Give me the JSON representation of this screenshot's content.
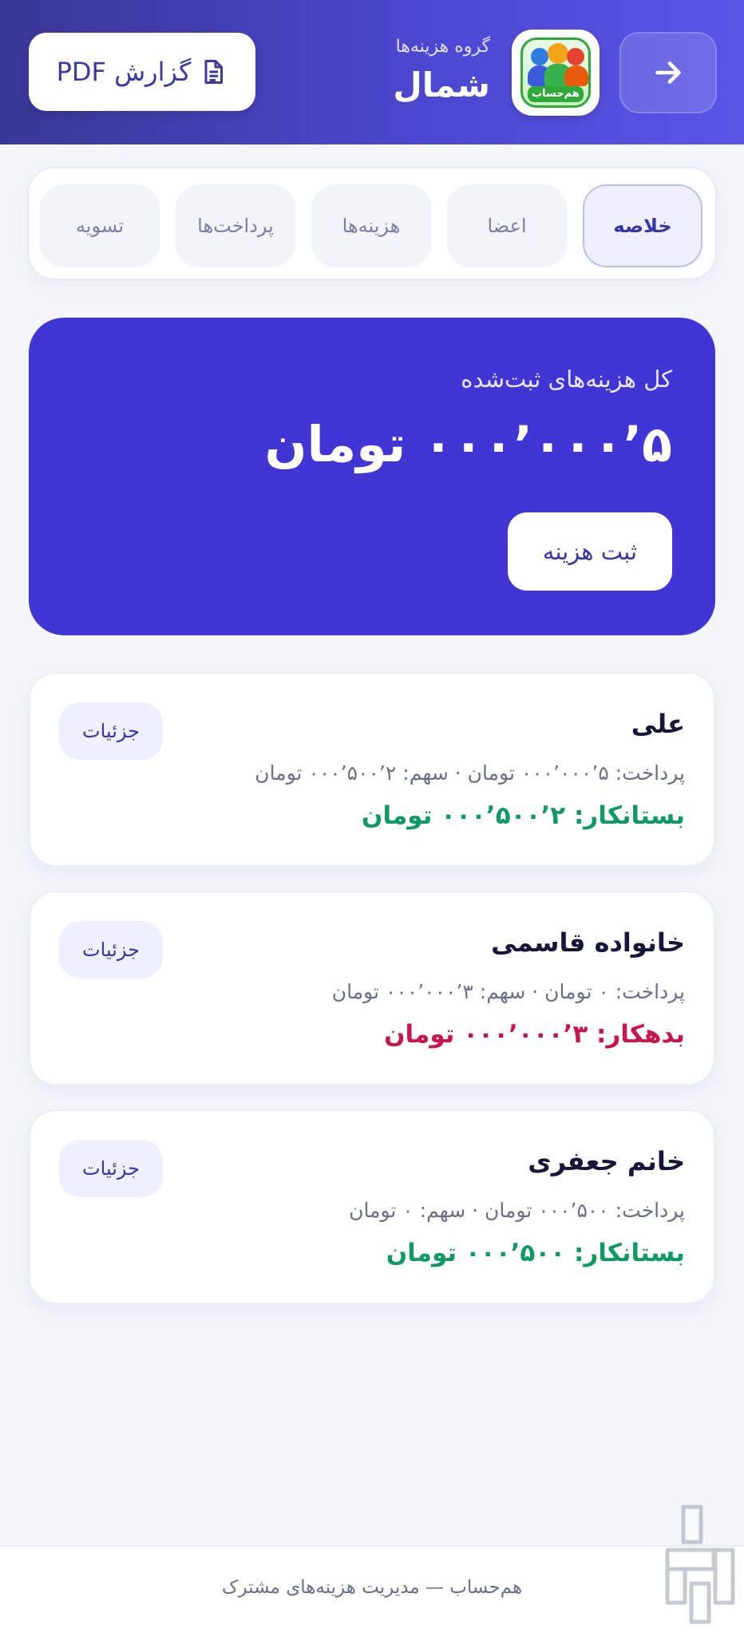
{
  "header": {
    "group_caption": "گروه هزینه‌ها",
    "group_name": "شمال",
    "pdf_label": "گزارش PDF",
    "logo_text": "هم‌حساب",
    "colors": {
      "gradient_start": "#3a3796",
      "gradient_end": "#5a55e6"
    }
  },
  "tabs": [
    {
      "label": "خلاصه",
      "active": true
    },
    {
      "label": "اعضا",
      "active": false
    },
    {
      "label": "هزینه‌ها",
      "active": false
    },
    {
      "label": "پرداخت‌ها",
      "active": false
    },
    {
      "label": "تسویه",
      "active": false
    }
  ],
  "summary": {
    "label": "کل هزینه‌های ثبت‌شده",
    "amount": "۵’۰۰۰’۰۰۰ تومان",
    "add_button": "ثبت هزینه",
    "color": "#4135d6"
  },
  "members": [
    {
      "name": "علی",
      "info": "پرداخت: ۵’۰۰۰’۰۰۰ تومان · سهم: ۲’۵۰۰’۰۰۰ تومان",
      "balance": "بستانکار: ۲’۵۰۰’۰۰۰ تومان",
      "status": "credit",
      "details": "جزئیات"
    },
    {
      "name": "خانواده قاسمی",
      "info": "پرداخت: ۰ تومان · سهم: ۳’۰۰۰’۰۰۰ تومان",
      "balance": "بدهکار: ۳’۰۰۰’۰۰۰ تومان",
      "status": "debt",
      "details": "جزئیات"
    },
    {
      "name": "خانم جعفری",
      "info": "پرداخت: ۵۰۰’۰۰۰ تومان · سهم: ۰ تومان",
      "balance": "بستانکار: ۵۰۰’۰۰۰ تومان",
      "status": "credit",
      "details": "جزئیات"
    }
  ],
  "status_colors": {
    "credit": "#0f9a63",
    "debt": "#c8154d"
  },
  "footer": {
    "text": "هم‌حساب — مدیریت هزینه‌های مشترک"
  },
  "icons": {
    "back": "arrow-right-icon",
    "pdf": "document-icon",
    "watermark": "bazaar-logo-icon"
  }
}
